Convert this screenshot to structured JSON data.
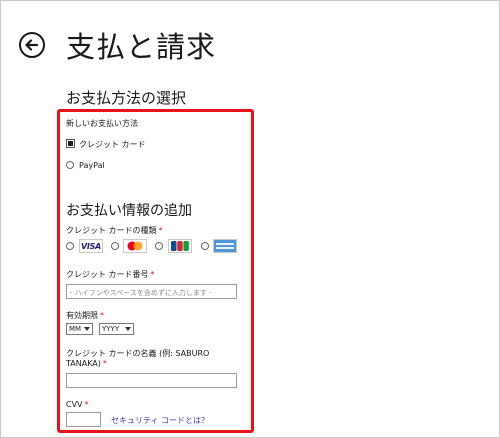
{
  "page": {
    "title": "支払と請求",
    "back_label": ""
  },
  "payment_method_section": {
    "title": "お支払方法の選択",
    "group_label": "新しいお支払い方法",
    "options": [
      {
        "label": "クレジット カード",
        "checked": true
      },
      {
        "label": "PayPal",
        "checked": false
      }
    ]
  },
  "payment_info": {
    "title": "お支払い情報の追加",
    "card_type_label": "クレジット カードの種類",
    "required_mark": "*",
    "card_types": [
      {
        "name": "VISA",
        "icon": "visa-logo-icon"
      },
      {
        "name": "MasterCard",
        "icon": "mastercard-logo-icon"
      },
      {
        "name": "JCB",
        "icon": "jcb-logo-icon"
      },
      {
        "name": "American Express",
        "icon": "amex-logo-icon"
      }
    ],
    "card_number_label": "クレジット カード番号",
    "card_number_placeholder": "- ハイフンやスペースを含めずに入力します -",
    "expiry_label": "有効期限",
    "expiry_month": "MM",
    "expiry_year": "YYYY",
    "name_label_line1": "クレジット カードの名義 (例: SABURO",
    "name_label_line2": "TANAKA)",
    "cvv_label": "CVV",
    "security_code_link": "セキュリティ コードとは?"
  },
  "colors": {
    "highlight_border": "#e8141b",
    "link": "#3a3ab8"
  }
}
